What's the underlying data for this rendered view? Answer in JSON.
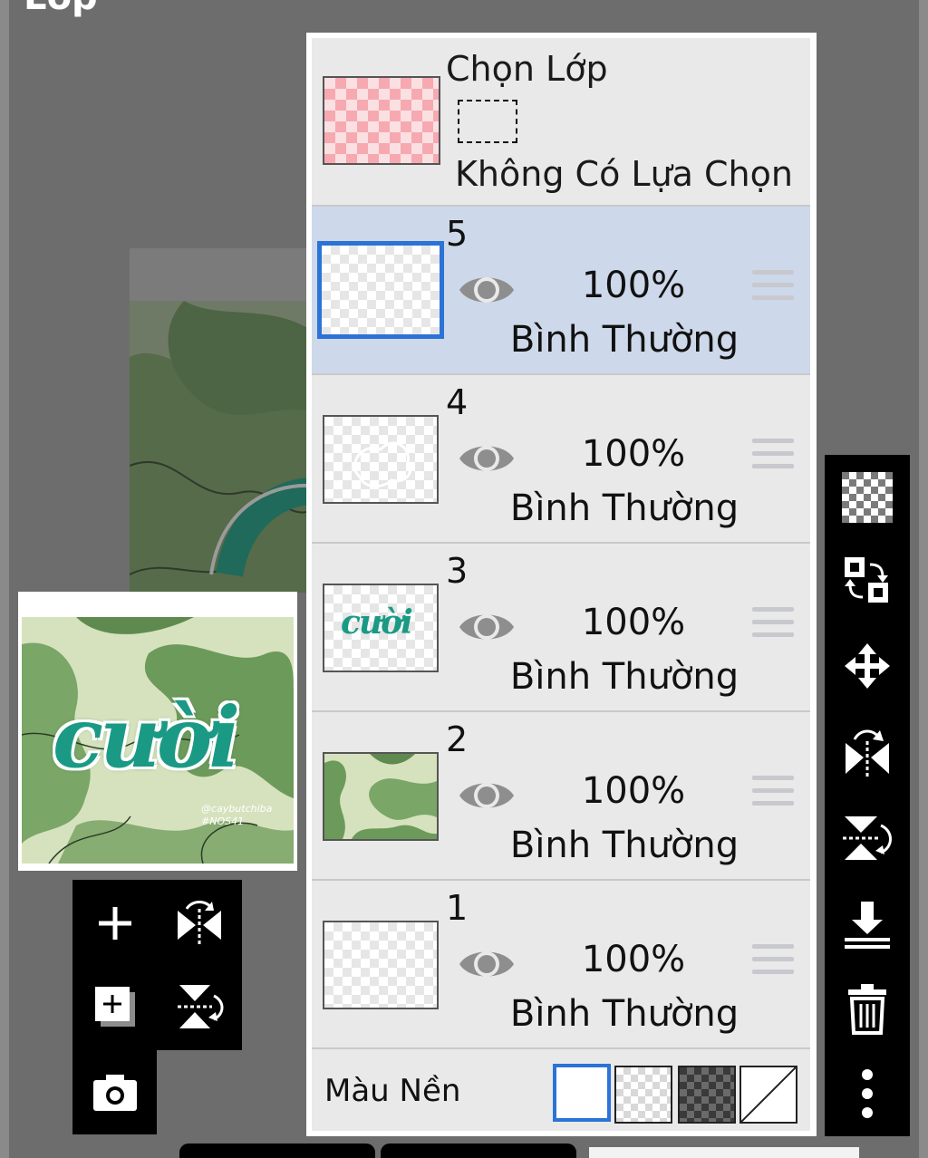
{
  "app": {
    "title": "Lớp"
  },
  "selection": {
    "title": "Chọn Lớp",
    "status": "Không Có Lựa Chọn"
  },
  "layers": [
    {
      "number": "5",
      "opacity": "100%",
      "mode": "Bình Thường",
      "selected": true
    },
    {
      "number": "4",
      "opacity": "100%",
      "mode": "Bình Thường",
      "selected": false
    },
    {
      "number": "3",
      "opacity": "100%",
      "mode": "Bình Thường",
      "selected": false,
      "thumb_text": "cười"
    },
    {
      "number": "2",
      "opacity": "100%",
      "mode": "Bình Thường",
      "selected": false
    },
    {
      "number": "1",
      "opacity": "100%",
      "mode": "Bình Thường",
      "selected": false
    }
  ],
  "background": {
    "label": "Màu Nền",
    "options": [
      "white",
      "transparent",
      "dark-checker",
      "none"
    ],
    "selected": "white"
  },
  "navigator": {
    "artwork_text": "cười",
    "credit_line1": "@caybutchiba",
    "credit_line2": "#NOS41"
  },
  "colors": {
    "accent": "#2b73d6",
    "selected_row": "#cdd8ea",
    "panel": "#e9e9e9",
    "art_green": "#1a9a84"
  },
  "toolbar_right": [
    "transparency-icon",
    "swap-layers-icon",
    "move-icon",
    "flip-horizontal-icon",
    "flip-vertical-icon",
    "merge-down-icon",
    "delete-icon",
    "more-icon"
  ],
  "toolbar_left": [
    "add-layer-icon",
    "flip-horizontal-icon",
    "add-layer-copy-icon",
    "flip-vertical-icon",
    "camera-icon"
  ]
}
